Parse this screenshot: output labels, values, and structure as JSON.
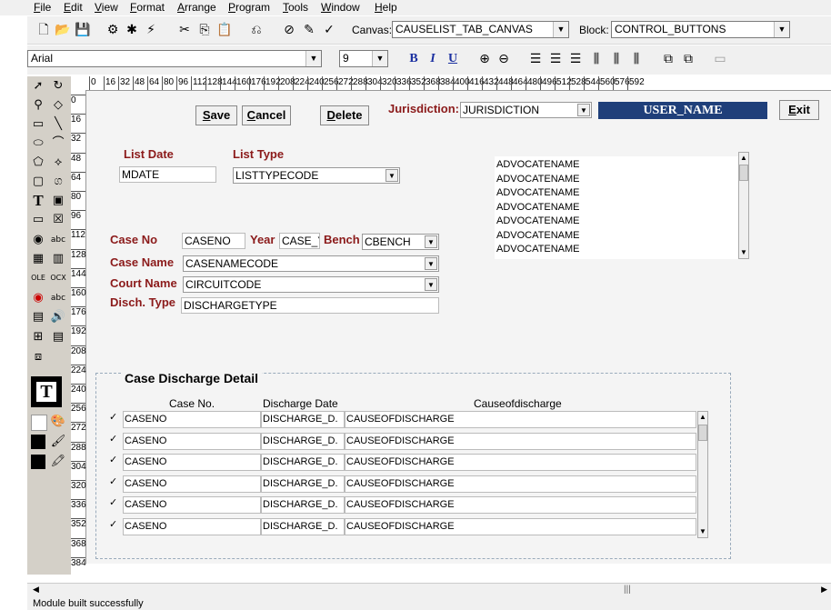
{
  "menu": [
    "File",
    "Edit",
    "View",
    "Format",
    "Arrange",
    "Program",
    "Tools",
    "Window",
    "Help"
  ],
  "toolbar": {
    "canvas_label": "Canvas:",
    "canvas_value": "CAUSELIST_TAB_CANVAS",
    "block_label": "Block:",
    "block_value": "CONTROL_BUTTONS",
    "font_value": "Arial",
    "font_size": "9",
    "bold": "B",
    "italic": "I",
    "underline": "U"
  },
  "ruler": {
    "top": [
      "0",
      "16",
      "32",
      "48",
      "64",
      "80",
      "96",
      "112",
      "128",
      "144",
      "160",
      "176",
      "192",
      "208",
      "224",
      "240",
      "256",
      "272",
      "288",
      "304",
      "320",
      "336",
      "352",
      "368",
      "384",
      "400",
      "416",
      "432",
      "448",
      "464",
      "480",
      "496",
      "512",
      "528",
      "544",
      "560",
      "576",
      "592"
    ],
    "left": [
      "0",
      "16",
      "32",
      "48",
      "64",
      "80",
      "96",
      "112",
      "128",
      "144",
      "160",
      "176",
      "192",
      "208",
      "224",
      "240",
      "256",
      "272",
      "288",
      "304",
      "320",
      "336",
      "352",
      "368",
      "384"
    ]
  },
  "form": {
    "save": "Save",
    "cancel": "Cancel",
    "delete": "Delete",
    "jurisdiction_label": "Jurisdiction:",
    "jurisdiction_value": "JURISDICTION",
    "user_name": "USER_NAME",
    "exit": "Exit",
    "list_date_label": "List Date",
    "list_date_value": "MDATE",
    "list_type_label": "List Type",
    "list_type_value": "LISTTYPECODE",
    "case_no_label": "Case No",
    "case_no_value": "CASENO",
    "year_label": "Year",
    "year_value": "CASE_Y",
    "bench_label": "Bench",
    "bench_value": "CBENCH",
    "case_name_label": "Case Name",
    "case_name_value": "CASENAMECODE",
    "court_name_label": "Court Name",
    "court_name_value": "CIRCUITCODE",
    "disch_type_label": "Disch. Type",
    "disch_type_value": "DISCHARGETYPE"
  },
  "advocates": [
    "ADVOCATENAME",
    "ADVOCATENAME",
    "ADVOCATENAME",
    "ADVOCATENAME",
    "ADVOCATENAME",
    "ADVOCATENAME",
    "ADVOCATENAME"
  ],
  "detail": {
    "title": "Case Discharge Detail",
    "col_case": "Case No.",
    "col_date": "Discharge Date",
    "col_cause": "Causeofdischarge",
    "rows": [
      {
        "check": "✓",
        "case": "CASENO",
        "date": "DISCHARGE_D.",
        "cause": "CAUSEOFDISCHARGE"
      },
      {
        "check": "✓",
        "case": "CASENO",
        "date": "DISCHARGE_D.",
        "cause": "CAUSEOFDISCHARGE"
      },
      {
        "check": "✓",
        "case": "CASENO",
        "date": "DISCHARGE_D.",
        "cause": "CAUSEOFDISCHARGE"
      },
      {
        "check": "✓",
        "case": "CASENO",
        "date": "DISCHARGE_D.",
        "cause": "CAUSEOFDISCHARGE"
      },
      {
        "check": "✓",
        "case": "CASENO",
        "date": "DISCHARGE_D.",
        "cause": "CAUSEOFDISCHARGE"
      },
      {
        "check": "✓",
        "case": "CASENO",
        "date": "DISCHARGE_D.",
        "cause": "CAUSEOFDISCHARGE"
      }
    ]
  },
  "status": "Module built successfully",
  "colors": {
    "label_red": "#8b1a1a",
    "user_name_bg": "#1f3f7a",
    "user_name_fg": "#ffffff"
  }
}
